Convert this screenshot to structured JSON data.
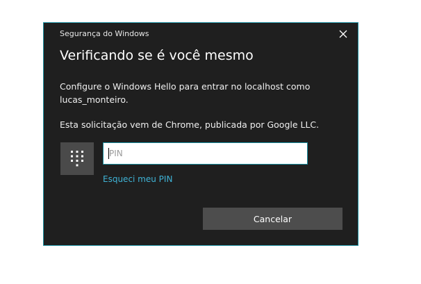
{
  "dialog": {
    "window_title": "Segurança do Windows",
    "heading": "Verificando se é você mesmo",
    "message": "Configure o Windows Hello para entrar no localhost como lucas_monteiro.",
    "request_info": "Esta solicitação vem de Chrome, publicada por Google LLC.",
    "pin_placeholder": "PIN",
    "pin_value": "",
    "forgot_pin_label": "Esqueci meu PIN",
    "cancel_label": "Cancelar",
    "icons": {
      "close": "close-icon",
      "keypad": "keypad-icon"
    },
    "colors": {
      "background": "#1f1f1f",
      "accent_border": "#1a8fa0",
      "link": "#3fb3d6",
      "button": "#4d4d4d"
    }
  }
}
